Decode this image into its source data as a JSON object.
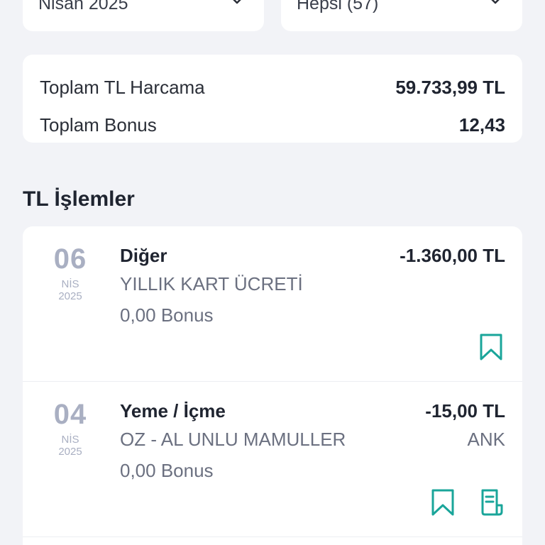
{
  "filters": {
    "period": {
      "value": "Nisan 2025"
    },
    "category": {
      "value": "Hepsi (57)"
    }
  },
  "summary": {
    "total_spend_label": "Toplam TL Harcama",
    "total_spend_value": "59.733,99 TL",
    "total_bonus_label": "Toplam Bonus",
    "total_bonus_value": "12,43"
  },
  "section": {
    "title": "TL İşlemler"
  },
  "transactions": [
    {
      "day": "06",
      "month": "NİS",
      "year": "2025",
      "category": "Diğer",
      "merchant": "YILLIK KART ÜCRETİ",
      "bonus": "0,00 Bonus",
      "amount": "-1.360,00 TL",
      "city": "",
      "icons": [
        "bookmark-icon"
      ]
    },
    {
      "day": "04",
      "month": "NİS",
      "year": "2025",
      "category": "Yeme / İçme",
      "merchant": "OZ - AL UNLU MAMULLER",
      "bonus": "0,00 Bonus",
      "amount": "-15,00 TL",
      "city": "ANK",
      "icons": [
        "bookmark-icon",
        "receipt-icon"
      ]
    }
  ],
  "colors": {
    "accent": "#1aa59a",
    "background": "#f2f3f7",
    "card": "#ffffff"
  }
}
